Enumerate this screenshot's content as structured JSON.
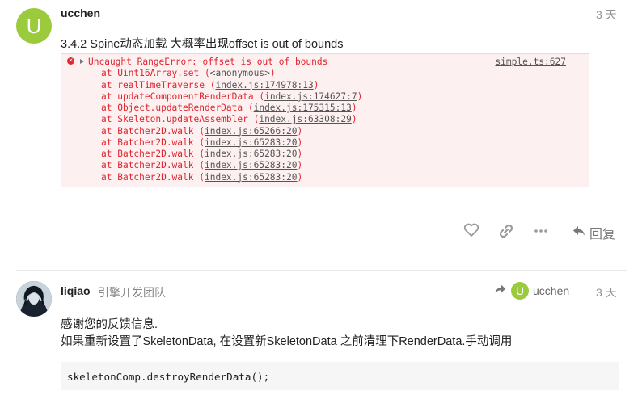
{
  "post1": {
    "avatar_letter": "U",
    "username": "ucchen",
    "date": "3 天",
    "title": "3.4.2 Spine动态加载 大概率出现offset is out of bounds",
    "error": {
      "first_prefix": "Uncaught RangeError: offset is out of bounds",
      "source": "simple.ts:627",
      "lines": [
        {
          "pre": "at Uint16Array.set (",
          "link": "",
          "mid": "<anonymous>",
          "post": ")"
        },
        {
          "pre": "at realTimeTraverse (",
          "link": "index.js:174978:13",
          "mid": "",
          "post": ")"
        },
        {
          "pre": "at updateComponentRenderData (",
          "link": "index.js:174627:7",
          "mid": "",
          "post": ")"
        },
        {
          "pre": "at Object.updateRenderData (",
          "link": "index.js:175315:13",
          "mid": "",
          "post": ")"
        },
        {
          "pre": "at Skeleton.updateAssembler (",
          "link": "index.js:63308:29",
          "mid": "",
          "post": ")"
        },
        {
          "pre": "at Batcher2D.walk (",
          "link": "index.js:65266:20",
          "mid": "",
          "post": ")"
        },
        {
          "pre": "at Batcher2D.walk (",
          "link": "index.js:65283:20",
          "mid": "",
          "post": ")"
        },
        {
          "pre": "at Batcher2D.walk (",
          "link": "index.js:65283:20",
          "mid": "",
          "post": ")"
        },
        {
          "pre": "at Batcher2D.walk (",
          "link": "index.js:65283:20",
          "mid": "",
          "post": ")"
        },
        {
          "pre": "at Batcher2D.walk (",
          "link": "index.js:65283:20",
          "mid": "",
          "post": ")"
        }
      ]
    },
    "actions": {
      "like_icon": "heart-icon",
      "link_icon": "link-icon",
      "more_icon": "more-icon",
      "reply_icon": "reply-arrow-icon",
      "reply_label": "回复"
    }
  },
  "post2": {
    "username": "liqiao",
    "group": "引擎开发团队",
    "reply_to": {
      "avatar_letter": "U",
      "username": "ucchen"
    },
    "date": "3 天",
    "line1": "感谢您的反馈信息.",
    "line2": "如果重新设置了SkeletonData, 在设置新SkeletonData 之前清理下RenderData.手动调用",
    "code": "skeletonComp.destroyRenderData();"
  },
  "colors": {
    "avatar": "#9bcb3c",
    "error_text": "#e0262f",
    "error_bg": "#fdf0f0"
  }
}
